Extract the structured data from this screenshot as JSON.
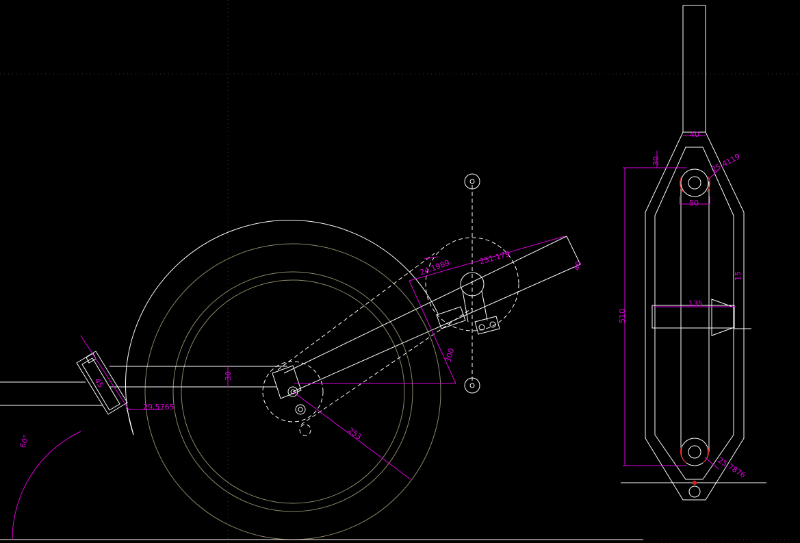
{
  "colors": {
    "background": "#000000",
    "geometry": "#ffffff",
    "dimension": "#e000e0",
    "wheel": "#8f8a6a",
    "highlight": "#e02020",
    "grid": "#3a3a3a"
  },
  "dimensions": {
    "d_30": "30",
    "d_29_5765": "29.5765",
    "d_60deg": "60°",
    "d_45": "45",
    "d_253": "253",
    "d_251_179": "251.179",
    "d_24_1989": "24.1989",
    "d_40_arm": "40",
    "d_300": "300",
    "d_40_top": "40",
    "d_30_side": "30",
    "d_25_4119": "25.4119",
    "d_50": "50",
    "d_135": "135",
    "d_510": "510",
    "d_15": "15",
    "d_25_7876": "25.7876"
  }
}
